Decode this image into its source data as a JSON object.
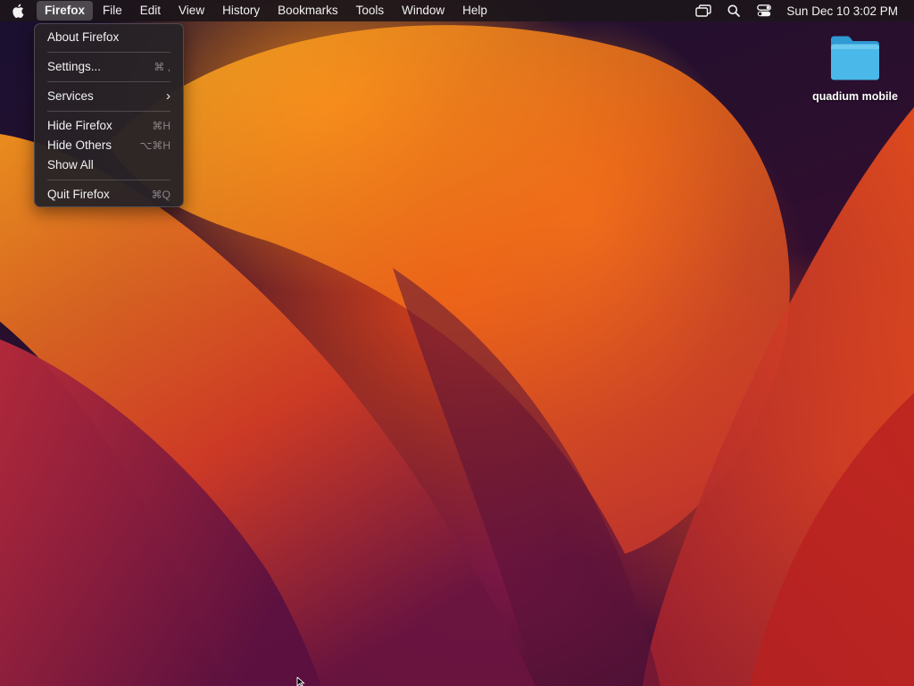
{
  "menubar": {
    "apple_icon": "apple-logo-icon",
    "items": [
      {
        "label": "Firefox"
      },
      {
        "label": "File"
      },
      {
        "label": "Edit"
      },
      {
        "label": "View"
      },
      {
        "label": "History"
      },
      {
        "label": "Bookmarks"
      },
      {
        "label": "Tools"
      },
      {
        "label": "Window"
      },
      {
        "label": "Help"
      }
    ],
    "status_icons": [
      "screen-mirroring-icon",
      "search-icon",
      "control-center-icon"
    ],
    "clock": "Sun Dec 10  3:02 PM"
  },
  "app_menu": {
    "items": [
      {
        "label": "About Firefox",
        "shortcut": ""
      },
      {
        "label": "Settings...",
        "shortcut": "⌘ ,"
      },
      {
        "label": "Services",
        "shortcut": ""
      },
      {
        "label": "Hide Firefox",
        "shortcut": "⌘H"
      },
      {
        "label": "Hide Others",
        "shortcut": "⌥⌘H"
      },
      {
        "label": "Show All",
        "shortcut": ""
      },
      {
        "label": "Quit Firefox",
        "shortcut": "⌘Q"
      }
    ]
  },
  "desktop": {
    "folder": {
      "label": "quadium mobile",
      "icon": "folder-icon",
      "color": "#4ab8e8"
    }
  },
  "colors": {
    "menubar_bg": "#1c161a",
    "menu_bg": "#282226",
    "accent_orange": "#f08a1c"
  }
}
